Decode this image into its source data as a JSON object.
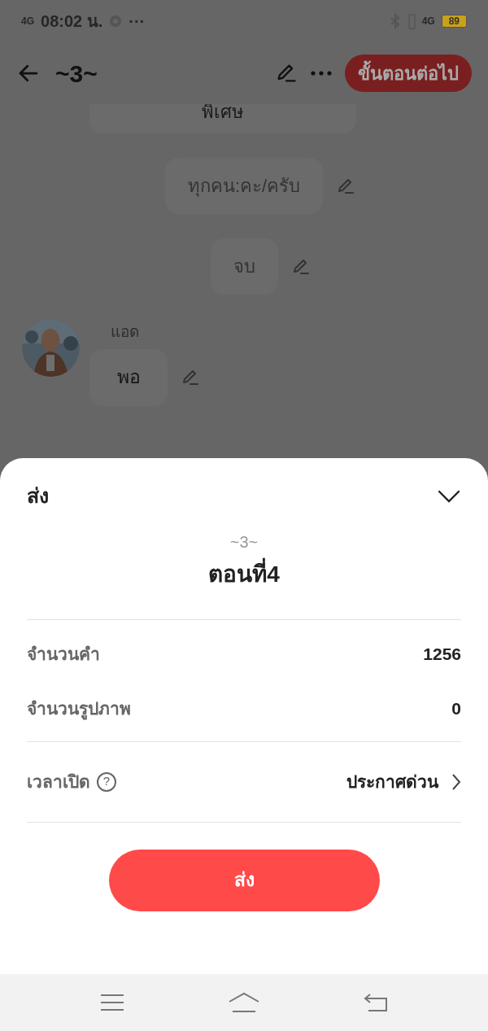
{
  "status_bar": {
    "network": "4G",
    "time": "08:02 น.",
    "more": "···",
    "network_right": "4G",
    "battery": "89"
  },
  "header": {
    "title": "~3~",
    "next_button": "ขั้นตอนต่อไป"
  },
  "messages": [
    {
      "kind": "narration",
      "text": "พิเศษ"
    },
    {
      "kind": "narration",
      "text": "ทุกคน:คะ/ครับ"
    },
    {
      "kind": "narration",
      "text": "จบ"
    },
    {
      "kind": "character",
      "name": "แอด",
      "text": "พอ"
    }
  ],
  "sheet": {
    "title": "ส่ง",
    "story": "~3~",
    "episode": "ตอนที่4",
    "stats": [
      {
        "label": "จำนวนคำ",
        "value": "1256"
      },
      {
        "label": "จำนวนรูปภาพ",
        "value": "0"
      }
    ],
    "publish": {
      "label": "เวลาเปิด",
      "help": "?",
      "value": "ประกาศด่วน"
    },
    "submit": "ส่ง"
  }
}
